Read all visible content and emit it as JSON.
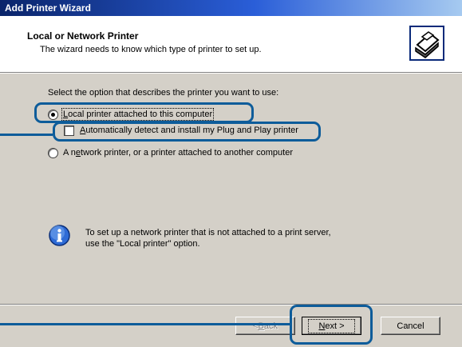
{
  "window": {
    "title": "Add Printer Wizard"
  },
  "header": {
    "title": "Local or Network Printer",
    "subtitle": "The wizard needs to know which type of printer to set up."
  },
  "body": {
    "prompt": "Select the option that describes the printer you want to use:",
    "options": {
      "local": {
        "prefix": "",
        "accel": "L",
        "rest": "ocal printer attached to this computer",
        "selected": true
      },
      "auto_detect": {
        "prefix": "",
        "accel": "A",
        "rest": "utomatically detect and install my Plug and Play printer",
        "checked": false
      },
      "network": {
        "prefix": "A n",
        "accel": "e",
        "rest": "twork printer, or a printer attached to another computer",
        "selected": false
      }
    },
    "info": {
      "line1": "To set up a network printer that is not attached to a print server,",
      "line2": "use the \"Local printer\" option.",
      "icon": "info-icon"
    }
  },
  "footer": {
    "back": {
      "prefix": "< ",
      "accel": "B",
      "rest": "ack",
      "enabled": false
    },
    "next": {
      "accel": "N",
      "rest": "ext >"
    },
    "cancel": {
      "label": "Cancel"
    }
  },
  "colors": {
    "callout": "#0d5c9a",
    "dialog_bg": "#d4d0c8",
    "title_start": "#0a246a",
    "title_end": "#a6caf0"
  }
}
